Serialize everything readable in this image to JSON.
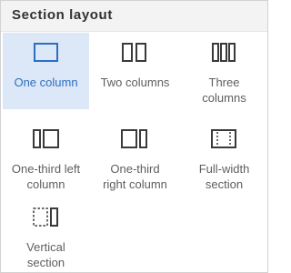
{
  "header": {
    "title": "Section layout"
  },
  "colors": {
    "selected_background": "#dce8f7",
    "selected_accent": "#2c6fc1",
    "icon_stroke": "#3b3a39",
    "label_text": "#605e5c"
  },
  "layouts": [
    {
      "label": "One column",
      "icon": "one-column-icon",
      "selected": true
    },
    {
      "label": "Two columns",
      "icon": "two-columns-icon",
      "selected": false
    },
    {
      "label_line1": "Three",
      "label_line2": "columns",
      "icon": "three-columns-icon",
      "selected": false
    },
    {
      "label_line1": "One-third left",
      "label_line2": "column",
      "icon": "one-third-left-column-icon",
      "selected": false
    },
    {
      "label_line1": "One-third",
      "label_line2": "right column",
      "icon": "one-third-right-column-icon",
      "selected": false
    },
    {
      "label_line1": "Full-width",
      "label_line2": "section",
      "icon": "full-width-section-icon",
      "selected": false
    },
    {
      "label_line1": "Vertical",
      "label_line2": "section",
      "icon": "vertical-section-icon",
      "selected": false
    }
  ]
}
